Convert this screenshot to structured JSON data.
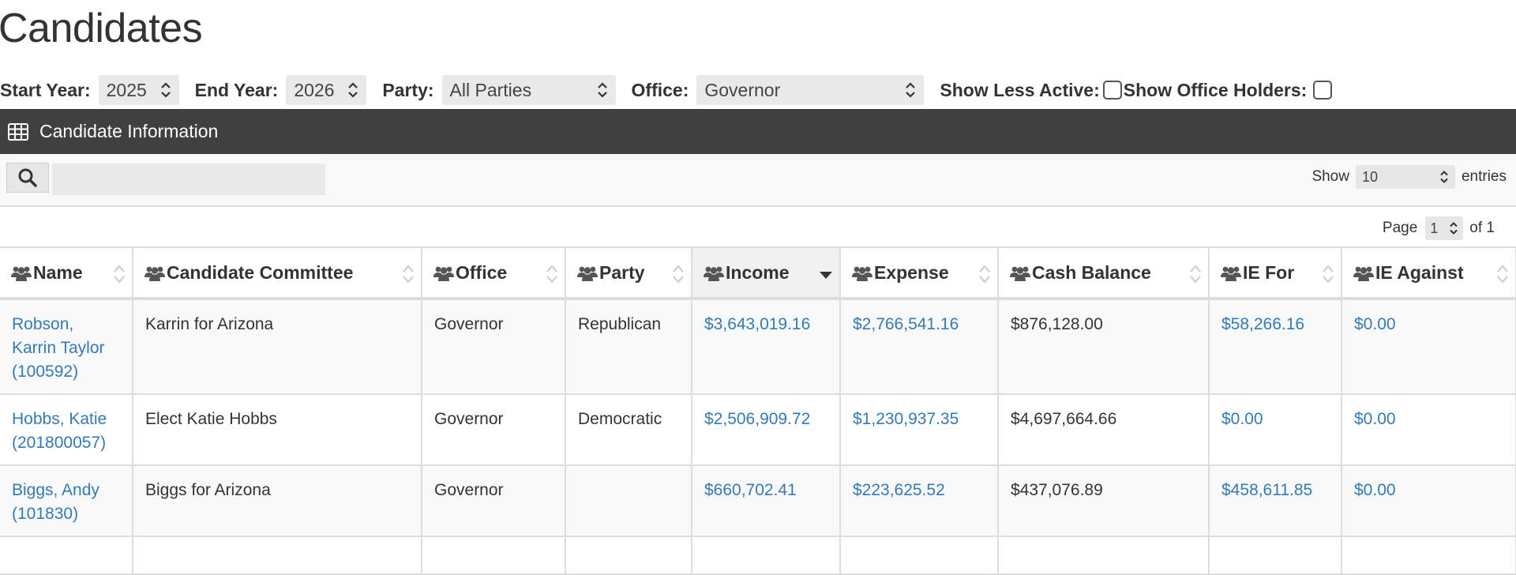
{
  "page_title": "Candidates",
  "filters": {
    "start_year_label": "Start Year:",
    "start_year": "2025",
    "end_year_label": "End Year:",
    "end_year": "2026",
    "party_label": "Party:",
    "party": "All Parties",
    "office_label": "Office:",
    "office": "Governor",
    "less_active_label": "Show Less Active:",
    "office_holders_label": "Show Office Holders:"
  },
  "panel": {
    "title": "Candidate Information",
    "icon": "table-icon"
  },
  "table_controls": {
    "search_icon": "search-icon",
    "search_value": "",
    "show_label": "Show",
    "page_length": "10",
    "entries_label": "entries",
    "page_label": "Page",
    "page_number": "1",
    "of_label": "of 1"
  },
  "columns": [
    "Name",
    "Candidate Committee",
    "Office",
    "Party",
    "Income",
    "Expense",
    "Cash Balance",
    "IE For",
    "IE Against"
  ],
  "column_icon": "group-icon",
  "sorted_column": "Income",
  "rows": [
    {
      "name_line1": "Robson,",
      "name_line2": "Karrin Taylor",
      "name_line3": "(100592)",
      "committee": "Karrin for Arizona",
      "office": "Governor",
      "party": "Republican",
      "income": "$3,643,019.16",
      "expense": "$2,766,541.16",
      "cash_balance": "$876,128.00",
      "ie_for": "$58,266.16",
      "ie_against": "$0.00"
    },
    {
      "name_line1": "Hobbs, Katie",
      "name_line2": "(201800057)",
      "committee": "Elect Katie Hobbs",
      "office": "Governor",
      "party": "Democratic",
      "income": "$2,506,909.72",
      "expense": "$1,230,937.35",
      "cash_balance": "$4,697,664.66",
      "ie_for": "$0.00",
      "ie_against": "$0.00"
    },
    {
      "name_line1": "Biggs, Andy",
      "name_line2": "(101830)",
      "committee": "Biggs for Arizona",
      "office": "Governor",
      "party": "",
      "income": "$660,702.41",
      "expense": "$223,625.52",
      "cash_balance": "$437,076.89",
      "ie_for": "$458,611.85",
      "ie_against": "$0.00"
    }
  ],
  "colors": {
    "link": "#337ab7",
    "panel_header": "#404040",
    "border": "#dddddd"
  }
}
